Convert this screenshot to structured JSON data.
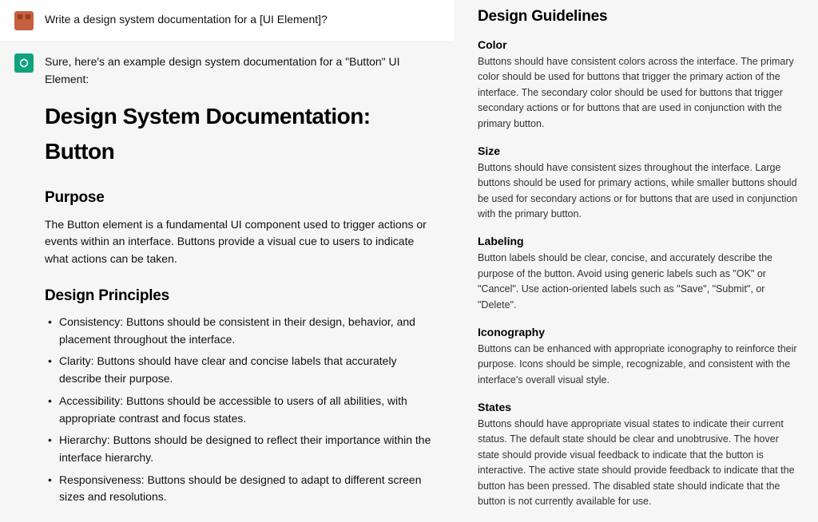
{
  "chat": {
    "user": {
      "text": "Write a design system documentation for a [UI Element]?"
    },
    "assistant": {
      "intro": "Sure, here's an example design system documentation for a \"Button\" UI Element:",
      "title": "Design System Documentation: Button",
      "purpose_heading": "Purpose",
      "purpose_text": "The Button element is a fundamental UI component used to trigger actions or events within an interface. Buttons provide a visual cue to users to indicate what actions can be taken.",
      "principles_heading": "Design Principles",
      "principles": [
        "Consistency: Buttons should be consistent in their design, behavior, and placement throughout the interface.",
        "Clarity: Buttons should have clear and concise labels that accurately describe their purpose.",
        "Accessibility: Buttons should be accessible to users of all abilities, with appropriate contrast and focus states.",
        "Hierarchy: Buttons should be designed to reflect their importance within the interface hierarchy.",
        "Responsiveness: Buttons should be designed to adapt to different screen sizes and resolutions."
      ]
    }
  },
  "guidelines": {
    "title": "Design Guidelines",
    "sections": [
      {
        "heading": "Color",
        "text": "Buttons should have consistent colors across the interface. The primary color should be used for buttons that trigger the primary action of the interface. The secondary color should be used for buttons that trigger secondary actions or for buttons that are used in conjunction with the primary button."
      },
      {
        "heading": "Size",
        "text": "Buttons should have consistent sizes throughout the interface. Large buttons should be used for primary actions, while smaller buttons should be used for secondary actions or for buttons that are used in conjunction with the primary button."
      },
      {
        "heading": "Labeling",
        "text": "Button labels should be clear, concise, and accurately describe the purpose of the button. Avoid using generic labels such as \"OK\" or \"Cancel\". Use action-oriented labels such as \"Save\", \"Submit\", or \"Delete\"."
      },
      {
        "heading": "Iconography",
        "text": "Buttons can be enhanced with appropriate iconography to reinforce their purpose. Icons should be simple, recognizable, and consistent with the interface's overall visual style."
      },
      {
        "heading": "States",
        "text": "Buttons should have appropriate visual states to indicate their current status. The default state should be clear and unobtrusive. The hover state should provide visual feedback to indicate that the button is interactive. The active state should provide feedback to indicate that the button has been pressed. The disabled state should indicate that the button is not currently available for use."
      }
    ]
  }
}
